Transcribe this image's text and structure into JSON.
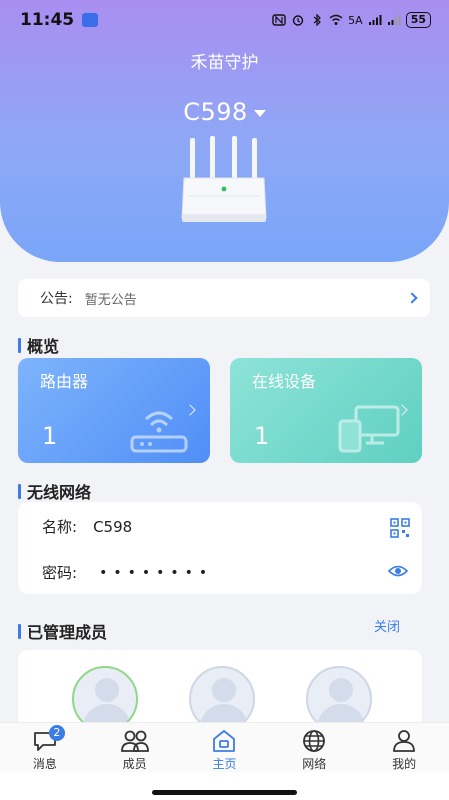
{
  "status_bar": {
    "time": "11:45",
    "network_label": "5A",
    "battery": "55"
  },
  "header": {
    "app_title": "禾苗守护",
    "device_name": "C598"
  },
  "notice": {
    "label": "公告:",
    "text": "暂无公告"
  },
  "overview": {
    "title": "概览",
    "router_card": {
      "title": "路由器",
      "count": "1"
    },
    "devices_card": {
      "title": "在线设备",
      "count": "1"
    }
  },
  "wireless": {
    "title": "无线网络",
    "name_label": "名称:",
    "name_value": "C598",
    "password_label": "密码:",
    "password_mask": "••••••••"
  },
  "members": {
    "title": "已管理成员",
    "close_label": "关闭",
    "avatars": [
      "avatar",
      "avatar",
      "avatar"
    ]
  },
  "bottom_nav": {
    "items": [
      {
        "label": "消息",
        "icon": "message-icon",
        "badge": "2"
      },
      {
        "label": "成员",
        "icon": "members-icon"
      },
      {
        "label": "主页",
        "icon": "home-icon",
        "active": true
      },
      {
        "label": "网络",
        "icon": "globe-icon"
      },
      {
        "label": "我的",
        "icon": "profile-icon"
      }
    ]
  },
  "colors": {
    "accent": "#3b7ce6",
    "header_top": "#a98ef0",
    "header_bottom": "#7aa6f8",
    "router_card": "#5a97f8",
    "devices_card": "#6fd8ca"
  }
}
